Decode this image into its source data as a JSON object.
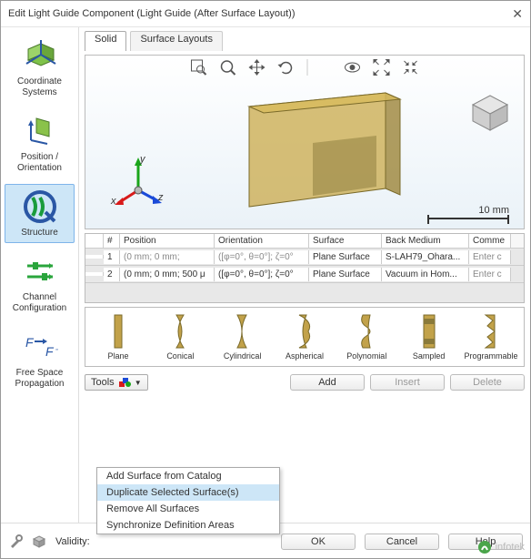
{
  "window": {
    "title": "Edit Light Guide Component (Light Guide (After Surface Layout))"
  },
  "sidebar": {
    "items": [
      {
        "label": "Coordinate Systems"
      },
      {
        "label": "Position / Orientation"
      },
      {
        "label": "Structure"
      },
      {
        "label": "Channel Configuration"
      },
      {
        "label": "Free Space Propagation"
      }
    ]
  },
  "tabs": {
    "solid": "Solid",
    "surface_layouts": "Surface Layouts"
  },
  "viewport": {
    "scale_label": "10 mm",
    "axes": {
      "x": "x",
      "y": "y",
      "z": "z"
    }
  },
  "table": {
    "headers": {
      "idx": "#",
      "position": "Position",
      "orientation": "Orientation",
      "surface": "Surface",
      "back_medium": "Back Medium",
      "comment": "Comme"
    },
    "rows": [
      {
        "idx": "1",
        "position": "(0 mm; 0 mm;",
        "orientation": "([φ=0°, θ=0°]; ζ=0°",
        "surface": "Plane Surface",
        "back_medium": "S-LAH79_Ohara...",
        "comment": "Enter c"
      },
      {
        "idx": "2",
        "position": "(0 mm; 0 mm; 500 μ",
        "orientation": "([φ=0°, θ=0°]; ζ=0°",
        "surface": "Plane Surface",
        "back_medium": "Vacuum in Hom...",
        "comment": "Enter c"
      }
    ]
  },
  "shapes": [
    {
      "label": "Plane"
    },
    {
      "label": "Conical"
    },
    {
      "label": "Cylindrical"
    },
    {
      "label": "Aspherical"
    },
    {
      "label": "Polynomial"
    },
    {
      "label": "Sampled"
    },
    {
      "label": "Programmable"
    }
  ],
  "buttons": {
    "tools": "Tools",
    "add": "Add",
    "insert": "Insert",
    "delete": "Delete",
    "ok": "OK",
    "cancel": "Cancel",
    "help": "Help"
  },
  "tools_menu": [
    "Add Surface from Catalog",
    "Duplicate Selected Surface(s)",
    "Remove All Surfaces",
    "Synchronize Definition Areas"
  ],
  "footer": {
    "validity": "Validity:"
  },
  "watermark": {
    "text": "infotek"
  }
}
